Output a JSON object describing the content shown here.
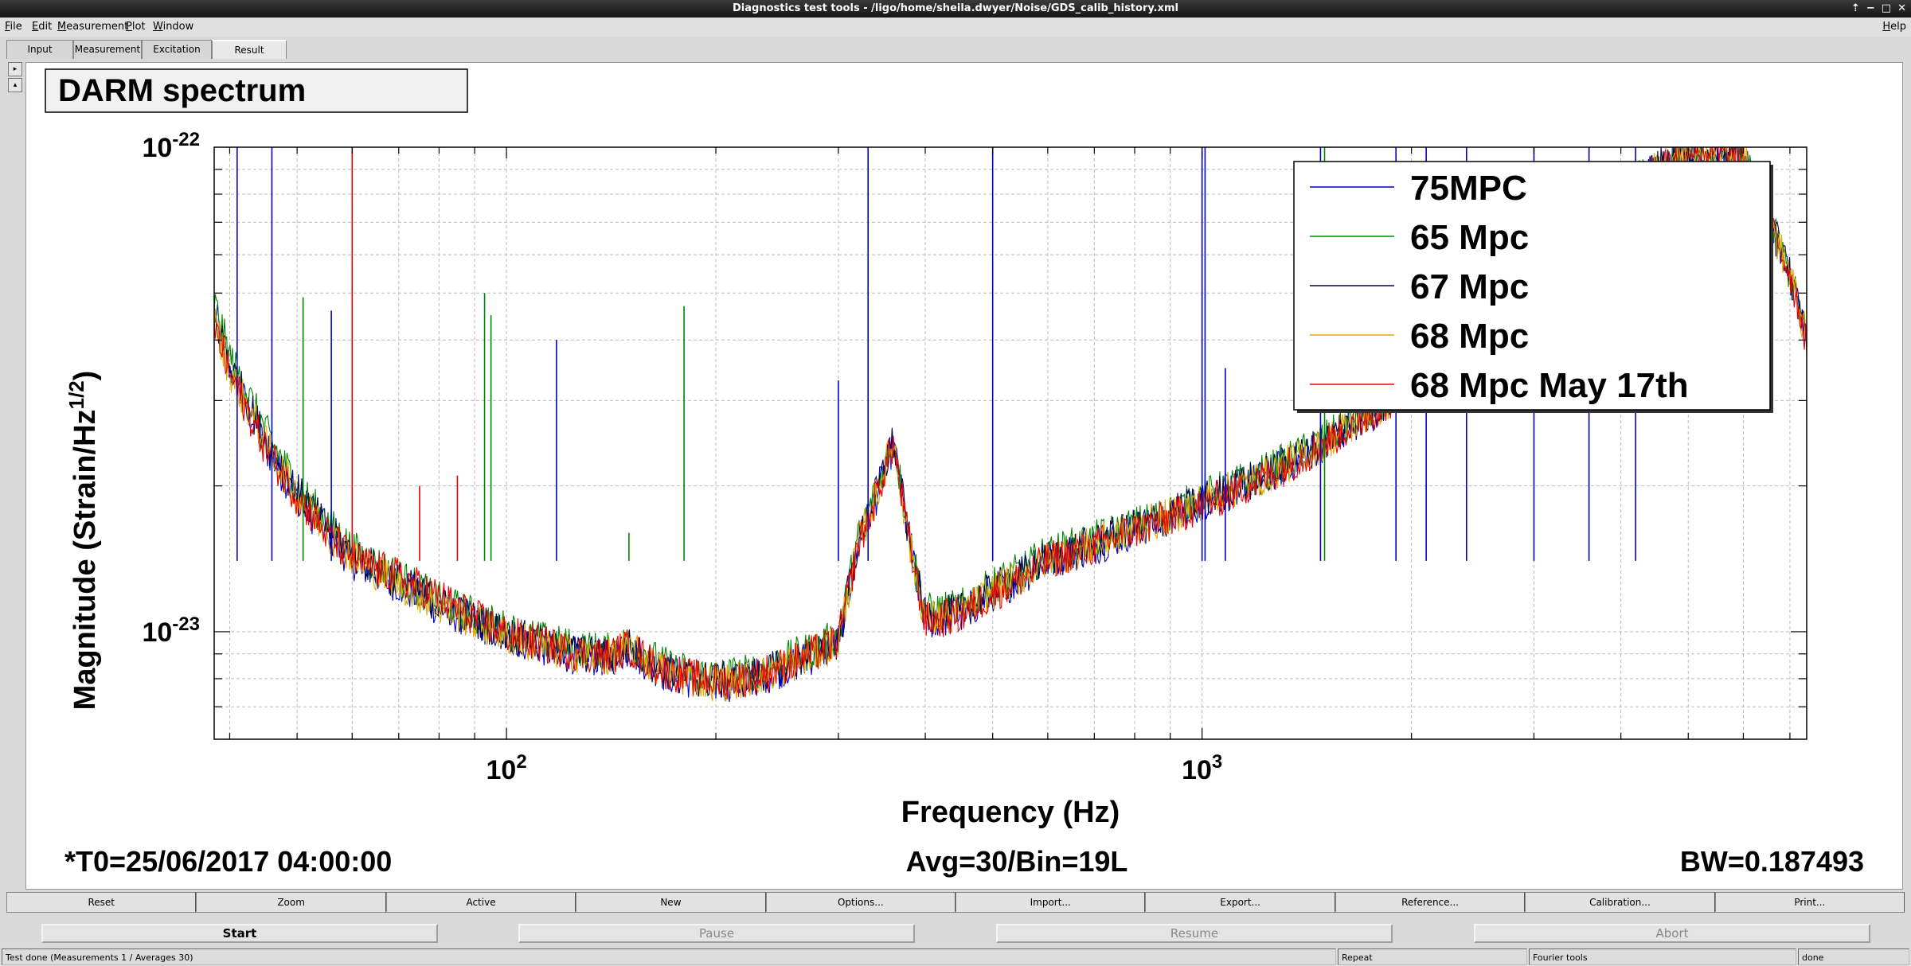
{
  "window": {
    "title": "Diagnostics test tools - /ligo/home/sheila.dwyer/Noise/GDS_calib_history.xml",
    "controls": [
      "⇡",
      "−",
      "□",
      "✕"
    ]
  },
  "menu": [
    "File",
    "Edit",
    "Measurement",
    "Plot",
    "Window"
  ],
  "help_label": "Help",
  "tabs": [
    {
      "label": "Input"
    },
    {
      "label": "Measurement"
    },
    {
      "label": "Excitation"
    },
    {
      "label": "Result"
    }
  ],
  "side_buttons": [
    "▸",
    "▴"
  ],
  "plot": {
    "title": "DARM spectrum",
    "ylabel_main": "Magnitude (Strain/Hz",
    "ylabel_sup": "1/2",
    "ylabel_end": ")",
    "xlabel": "Frequency (Hz)",
    "y_ticks": [
      {
        "base": "10",
        "exp": "-22",
        "value": 1e-22
      },
      {
        "base": "10",
        "exp": "-23",
        "value": 1e-23
      }
    ],
    "x_ticks": [
      {
        "base": "10",
        "exp": "2",
        "value": 100
      },
      {
        "base": "10",
        "exp": "3",
        "value": 1000
      }
    ],
    "footer_left": "*T0=25/06/2017 04:00:00",
    "footer_center": "Avg=30/Bin=19L",
    "footer_right": "BW=0.187493"
  },
  "chart_data": {
    "type": "line",
    "title": "DARM spectrum",
    "xlabel": "Frequency (Hz)",
    "ylabel": "Magnitude (Strain/Hz1/2)",
    "xscale": "log",
    "yscale": "log",
    "xlim": [
      38,
      7400
    ],
    "ylim": [
      6e-24,
      1e-22
    ],
    "grid": true,
    "legend_position": "top-right",
    "x": [
      38,
      40,
      45,
      50,
      55,
      60,
      70,
      80,
      90,
      100,
      110,
      120,
      130,
      140,
      150,
      160,
      170,
      180,
      190,
      200,
      220,
      240,
      260,
      280,
      300,
      320,
      340,
      360,
      380,
      400,
      450,
      500,
      550,
      600,
      700,
      800,
      900,
      1000,
      1200,
      1400,
      1600,
      1800,
      2000,
      2500,
      3000,
      3500,
      4000,
      5000,
      6000,
      7000,
      7400
    ],
    "series": [
      {
        "name": "75MPC",
        "color": "#0000cc",
        "values": [
          4.6e-23,
          3.5e-23,
          2.4e-23,
          1.9e-23,
          1.6e-23,
          1.4e-23,
          1.25e-23,
          1.12e-23,
          1.05e-23,
          9.8e-24,
          9.4e-24,
          9e-24,
          8.9e-24,
          8.8e-24,
          9.2e-24,
          8.6e-24,
          8.2e-24,
          8e-24,
          7.9e-24,
          7.8e-24,
          7.9e-24,
          8.2e-24,
          8.6e-24,
          9e-24,
          9.5e-24,
          1.5e-23,
          1.9e-23,
          2.45e-23,
          1.5e-23,
          1.05e-23,
          1.08e-23,
          1.2e-23,
          1.3e-23,
          1.4e-23,
          1.5e-23,
          1.62e-23,
          1.72e-23,
          1.85e-23,
          2.05e-23,
          2.3e-23,
          2.6e-23,
          2.9e-23,
          3.2e-23,
          4.1e-23,
          5.2e-23,
          6.5e-23,
          8e-23,
          1e-22,
          9.5e-23,
          5.5e-23,
          4e-23
        ]
      },
      {
        "name": "65 Mpc",
        "color": "#008800",
        "values": [
          4.8e-23,
          3.7e-23,
          2.6e-23,
          2e-23,
          1.7e-23,
          1.48e-23,
          1.3e-23,
          1.16e-23,
          1.08e-23,
          1.01e-23,
          9.7e-24,
          9.4e-24,
          9.2e-24,
          9.1e-24,
          9.5e-24,
          8.9e-24,
          8.5e-24,
          8.3e-24,
          8.2e-24,
          8.1e-24,
          8.2e-24,
          8.5e-24,
          8.9e-24,
          9.3e-24,
          9.8e-24,
          1.55e-23,
          1.95e-23,
          2.5e-23,
          1.55e-23,
          1.1e-23,
          1.12e-23,
          1.25e-23,
          1.34e-23,
          1.45e-23,
          1.55e-23,
          1.66e-23,
          1.76e-23,
          1.9e-23,
          2.1e-23,
          2.35e-23,
          2.65e-23,
          2.95e-23,
          3.3e-23,
          4.2e-23,
          5.3e-23,
          6.6e-23,
          8.1e-23,
          1e-22,
          9.5e-23,
          5.5e-23,
          4e-23
        ]
      },
      {
        "name": "67 Mpc",
        "color": "#000055",
        "values": [
          4.5e-23,
          3.55e-23,
          2.5e-23,
          1.95e-23,
          1.65e-23,
          1.44e-23,
          1.27e-23,
          1.14e-23,
          1.06e-23,
          9.9e-24,
          9.5e-24,
          9.2e-24,
          9e-24,
          8.9e-24,
          9.3e-24,
          8.7e-24,
          8.3e-24,
          8.1e-24,
          8e-24,
          7.9e-24,
          8e-24,
          8.3e-24,
          8.7e-24,
          9.1e-24,
          9.6e-24,
          1.52e-23,
          1.92e-23,
          2.48e-23,
          1.52e-23,
          1.07e-23,
          1.1e-23,
          1.22e-23,
          1.31e-23,
          1.42e-23,
          1.52e-23,
          1.64e-23,
          1.74e-23,
          1.87e-23,
          2.07e-23,
          2.32e-23,
          2.62e-23,
          2.92e-23,
          3.25e-23,
          4.15e-23,
          5.25e-23,
          6.55e-23,
          8.05e-23,
          1e-22,
          9.5e-23,
          5.5e-23,
          4e-23
        ]
      },
      {
        "name": "68 Mpc",
        "color": "#ddaa00",
        "values": [
          4.4e-23,
          3.45e-23,
          2.45e-23,
          1.92e-23,
          1.62e-23,
          1.42e-23,
          1.26e-23,
          1.13e-23,
          1.05e-23,
          9.8e-24,
          9.4e-24,
          9.1e-24,
          8.95e-24,
          8.85e-24,
          9.25e-24,
          8.65e-24,
          8.25e-24,
          8.05e-24,
          7.95e-24,
          7.85e-24,
          7.95e-24,
          8.25e-24,
          8.65e-24,
          9.05e-24,
          9.55e-24,
          1.51e-23,
          1.91e-23,
          2.47e-23,
          1.51e-23,
          1.06e-23,
          1.09e-23,
          1.21e-23,
          1.3e-23,
          1.41e-23,
          1.51e-23,
          1.63e-23,
          1.73e-23,
          1.86e-23,
          2.06e-23,
          2.31e-23,
          2.61e-23,
          2.91e-23,
          3.22e-23,
          4.12e-23,
          5.22e-23,
          6.52e-23,
          8.02e-23,
          1e-22,
          9.5e-23,
          5.5e-23,
          4e-23
        ]
      },
      {
        "name": "68 Mpc May 17th",
        "color": "#ee0000",
        "values": [
          4.3e-23,
          3.4e-23,
          2.4e-23,
          1.9e-23,
          1.6e-23,
          1.41e-23,
          1.3e-23,
          1.18e-23,
          1.07e-23,
          9.9e-24,
          9.5e-24,
          9.2e-24,
          9e-24,
          8.9e-24,
          9.3e-24,
          8.7e-24,
          8.3e-24,
          8.1e-24,
          8e-24,
          7.9e-24,
          8e-24,
          8.3e-24,
          8.7e-24,
          9.1e-24,
          9.6e-24,
          1.5e-23,
          1.9e-23,
          2.45e-23,
          1.5e-23,
          1.05e-23,
          1.08e-23,
          1.2e-23,
          1.29e-23,
          1.4e-23,
          1.5e-23,
          1.62e-23,
          1.72e-23,
          1.82e-23,
          2.04e-23,
          2.3e-23,
          2.6e-23,
          2.9e-23,
          3.2e-23,
          4.1e-23,
          5.2e-23,
          6.5e-23,
          8e-23,
          1e-22,
          9.5e-23,
          5.5e-23,
          4e-23
        ]
      }
    ],
    "peaks": [
      {
        "x": 41,
        "y": 1e-22,
        "color": "#0000cc"
      },
      {
        "x": 46,
        "y": 1e-22,
        "color": "#0000cc"
      },
      {
        "x": 51,
        "y": 4.9e-23,
        "color": "#008800"
      },
      {
        "x": 56,
        "y": 4.6e-23,
        "color": "#0000cc"
      },
      {
        "x": 60,
        "y": 1e-22,
        "color": "#ee0000"
      },
      {
        "x": 75,
        "y": 2e-23,
        "color": "#ee0000"
      },
      {
        "x": 85,
        "y": 2.1e-23,
        "color": "#ee0000"
      },
      {
        "x": 93,
        "y": 5e-23,
        "color": "#008800"
      },
      {
        "x": 95,
        "y": 4.5e-23,
        "color": "#008800"
      },
      {
        "x": 118,
        "y": 4e-23,
        "color": "#0000cc"
      },
      {
        "x": 150,
        "y": 1.6e-23,
        "color": "#008800"
      },
      {
        "x": 180,
        "y": 4.7e-23,
        "color": "#008800"
      },
      {
        "x": 300,
        "y": 3.3e-23,
        "color": "#0000cc"
      },
      {
        "x": 331,
        "y": 1e-22,
        "color": "#0000cc"
      },
      {
        "x": 500,
        "y": 1e-22,
        "color": "#0000cc"
      },
      {
        "x": 1000,
        "y": 1e-22,
        "color": "#0000cc"
      },
      {
        "x": 1010,
        "y": 1e-22,
        "color": "#0000cc"
      },
      {
        "x": 1080,
        "y": 3.5e-23,
        "color": "#0000cc"
      },
      {
        "x": 1480,
        "y": 1e-22,
        "color": "#0000cc"
      },
      {
        "x": 1500,
        "y": 1e-22,
        "color": "#008800"
      },
      {
        "x": 1900,
        "y": 1e-22,
        "color": "#0000cc"
      },
      {
        "x": 2100,
        "y": 1e-22,
        "color": "#0000cc"
      },
      {
        "x": 2400,
        "y": 1e-22,
        "color": "#0000cc"
      },
      {
        "x": 3000,
        "y": 1e-22,
        "color": "#0000cc"
      },
      {
        "x": 3600,
        "y": 1e-22,
        "color": "#0000cc"
      },
      {
        "x": 4200,
        "y": 1e-22,
        "color": "#0000cc"
      }
    ]
  },
  "toolbar": [
    "Reset",
    "Zoom",
    "Active",
    "New",
    "Options...",
    "Import...",
    "Export...",
    "Reference...",
    "Calibration...",
    "Print..."
  ],
  "controls": [
    {
      "label": "Start",
      "enabled": true
    },
    {
      "label": "Pause",
      "enabled": false
    },
    {
      "label": "Resume",
      "enabled": false
    },
    {
      "label": "Abort",
      "enabled": false
    }
  ],
  "status": {
    "message": "Test done (Measurements 1 / Averages 30)",
    "repeat": "Repeat",
    "tool": "Fourier tools",
    "state": "done"
  }
}
